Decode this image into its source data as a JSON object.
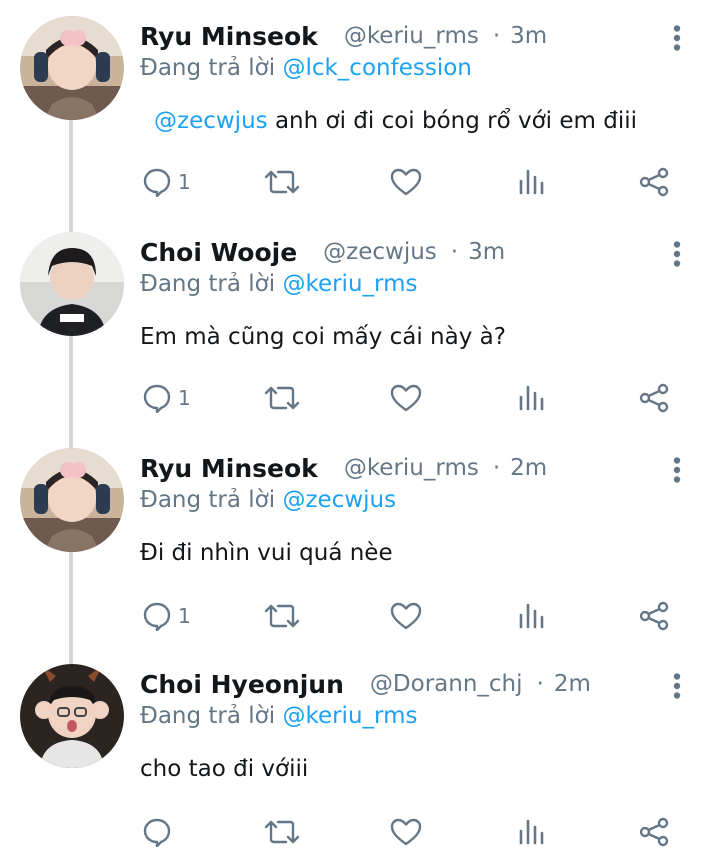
{
  "colors": {
    "accent": "#1da1f2",
    "secondary": "#657786",
    "text": "#14171a",
    "thread_line": "#cfd9de"
  },
  "tweets": [
    {
      "name": "Ryu Minseok",
      "handle": "@keriu_rms",
      "dot": "·",
      "time": "3m",
      "reply_prefix": "Đang trả lời",
      "reply_to": "@lck_confession",
      "text_mention": "@zecwjus",
      "text": "anh ơi đi coi bóng rổ với em điii",
      "reply_count": "1",
      "avatar": "avatar-ryu-minseok"
    },
    {
      "name": "Choi Wooje",
      "handle": "@zecwjus",
      "dot": "·",
      "time": "3m",
      "reply_prefix": "Đang trả lời",
      "reply_to": "@keriu_rms",
      "text_mention": "",
      "text": "Em mà cũng coi mấy cái này à?",
      "reply_count": "1",
      "avatar": "avatar-choi-wooje"
    },
    {
      "name": "Ryu Minseok",
      "handle": "@keriu_rms",
      "dot": "·",
      "time": "2m",
      "reply_prefix": "Đang trả lời",
      "reply_to": "@zecwjus",
      "text_mention": "",
      "text": "Đi đi nhìn vui quá nèe",
      "reply_count": "1",
      "avatar": "avatar-ryu-minseok"
    },
    {
      "name": "Choi Hyeonjun",
      "handle": "@Dorann_chj",
      "dot": "·",
      "time": "2m",
      "reply_prefix": "Đang trả lời",
      "reply_to": "@keriu_rms",
      "text_mention": "",
      "text": "cho tao đi vớiii",
      "reply_count": "",
      "avatar": "avatar-choi-hyeonjun"
    }
  ]
}
